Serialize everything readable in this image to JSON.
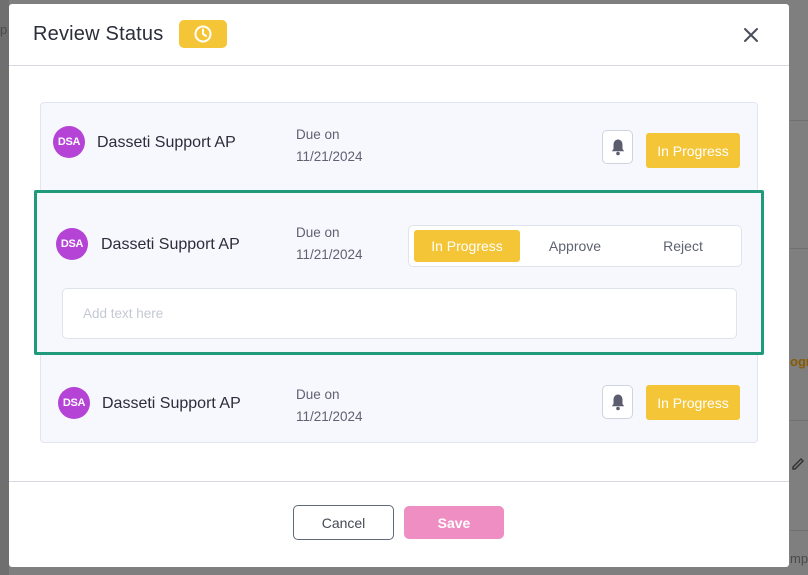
{
  "background": {
    "fragments": [
      "p",
      "ogr",
      "mp"
    ]
  },
  "modal": {
    "title": "Review Status",
    "header_icon": "clock-icon",
    "close_icon": "close-icon"
  },
  "reviewers": [
    {
      "initials": "DSA",
      "name": "Dasseti Support AP",
      "due_label": "Due on",
      "due_date": "11/21/2024",
      "status": "In Progress"
    },
    {
      "initials": "DSA",
      "name": "Dasseti Support AP",
      "due_label": "Due on",
      "due_date": "11/21/2024",
      "options": [
        "In Progress",
        "Approve",
        "Reject"
      ],
      "selected": "In Progress",
      "comment_placeholder": "Add text here"
    },
    {
      "initials": "DSA",
      "name": "Dasseti Support AP",
      "due_label": "Due on",
      "due_date": "11/21/2024",
      "status": "In Progress"
    }
  ],
  "footer": {
    "cancel_label": "Cancel",
    "save_label": "Save"
  },
  "colors": {
    "accent_yellow": "#f4c537",
    "avatar_purple": "#b443d6",
    "highlight_green": "#1f9a7a",
    "save_pink": "#ef8ec3"
  }
}
